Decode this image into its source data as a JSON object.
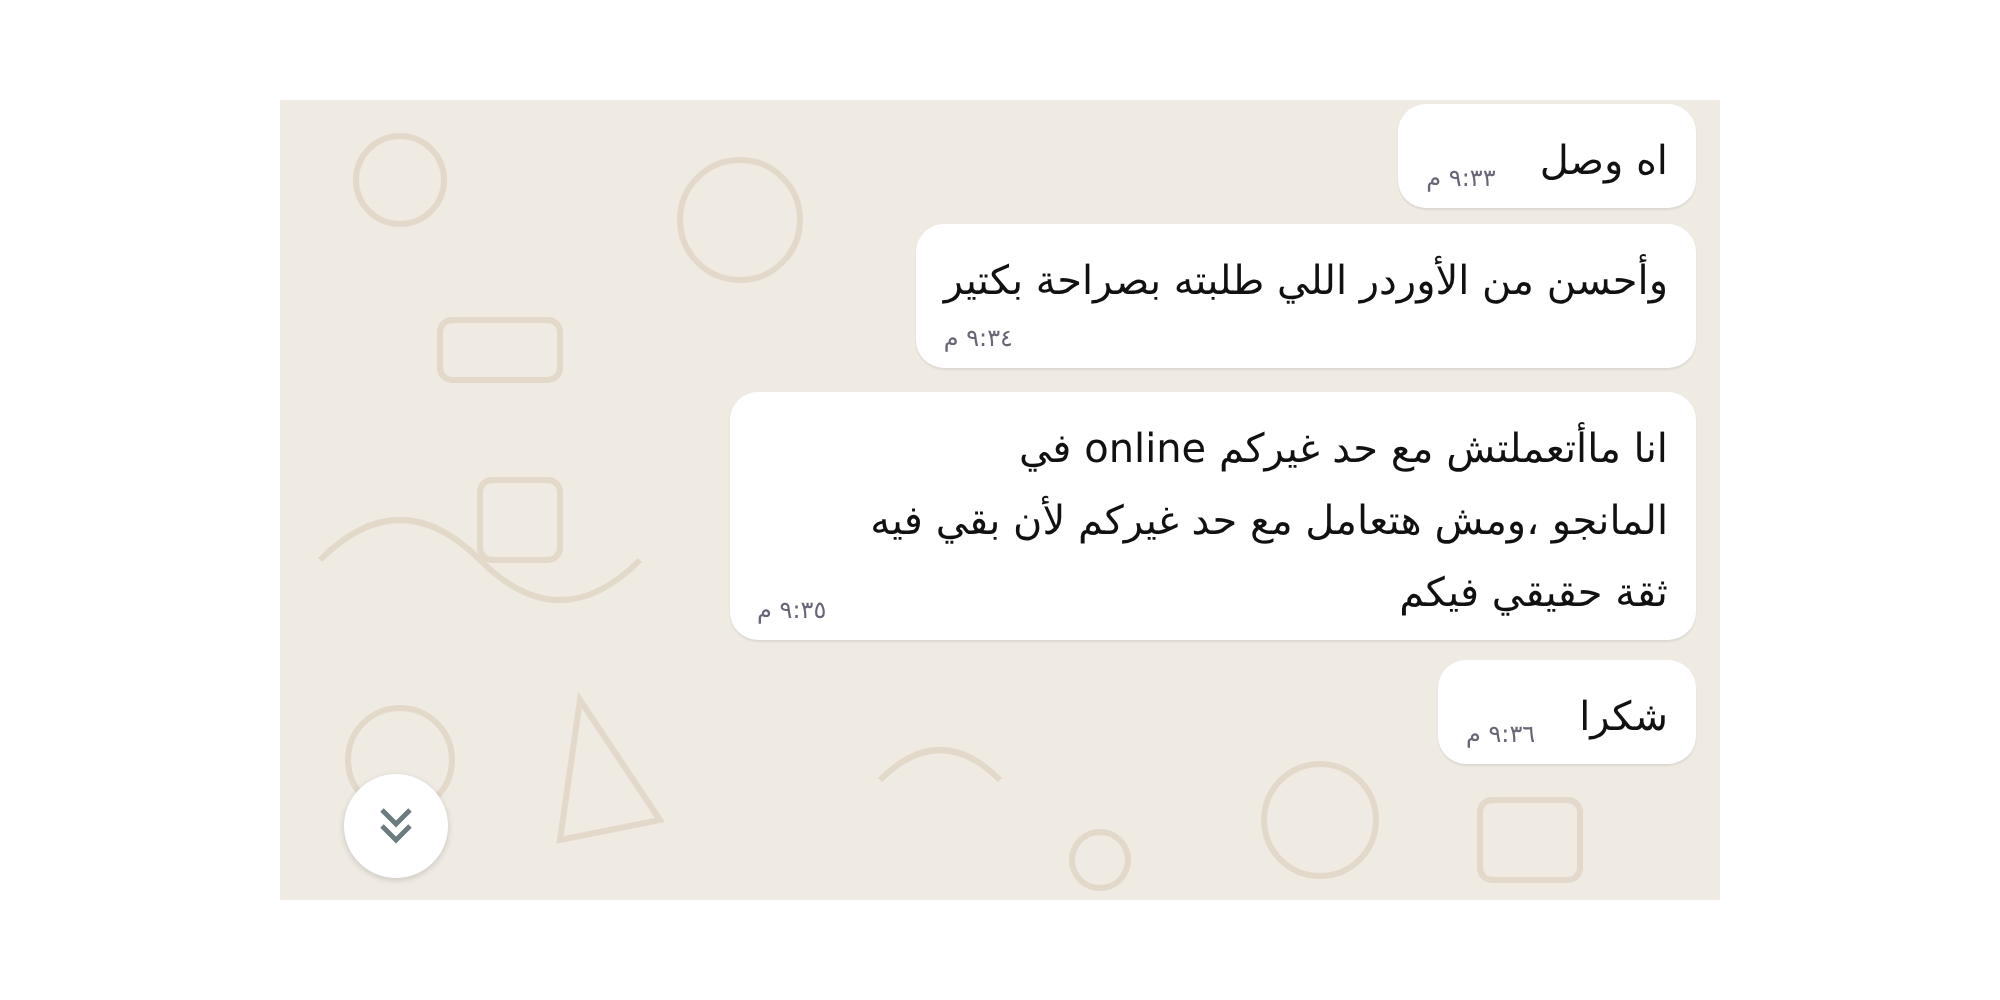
{
  "messages": [
    {
      "lines": [
        "اه وصل"
      ],
      "time": "٩:٣٣ م",
      "kind": "inline"
    },
    {
      "lines": [
        "وأحسن من الأوردر اللي طلبته بصراحة بكتير"
      ],
      "time": "٩:٣٤ م",
      "kind": "below"
    },
    {
      "lines": [
        "انا ماأتعملتش مع حد غيركم online في",
        "المانجو ،ومش هتعامل مع حد غيركم لأن بقي فيه",
        "ثقة حقيقي فيكم"
      ],
      "time": "٩:٣٥ م",
      "kind": "inline"
    },
    {
      "lines": [
        "شكرا"
      ],
      "time": "٩:٣٦ م",
      "kind": "inline"
    }
  ]
}
